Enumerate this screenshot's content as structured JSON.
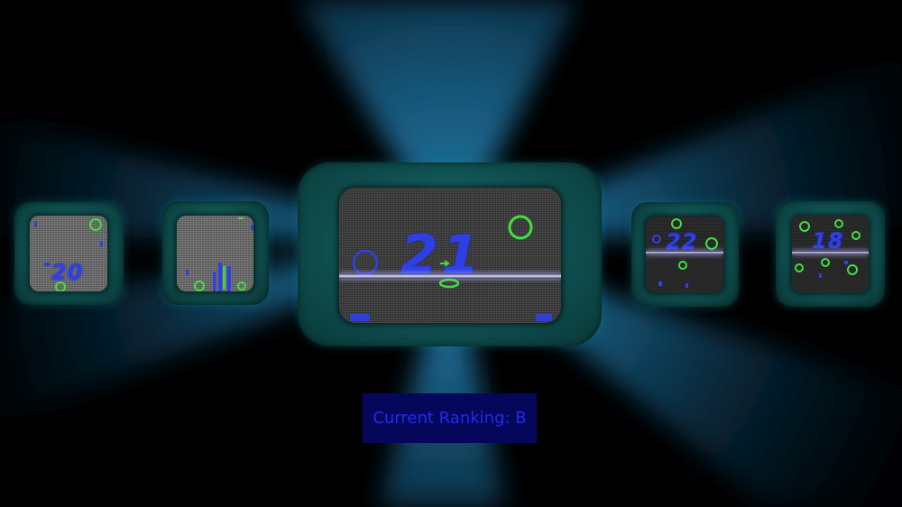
{
  "ranking": {
    "label": "Current Ranking: B"
  },
  "screens": [
    {
      "name": "level-screen-1",
      "number": "20"
    },
    {
      "name": "level-screen-2",
      "number": ""
    },
    {
      "name": "level-screen-3-selected",
      "number": "21"
    },
    {
      "name": "level-screen-4",
      "number": "22"
    },
    {
      "name": "level-screen-5",
      "number": "18"
    }
  ],
  "colors": {
    "background_ray": "#1a6a95",
    "tv_frame": "#0f4f4f",
    "number_blue": "#2f3fe6",
    "ring_green": "#3fe03f",
    "ranking_box": "#05085a",
    "ranking_text": "#2229ee"
  }
}
